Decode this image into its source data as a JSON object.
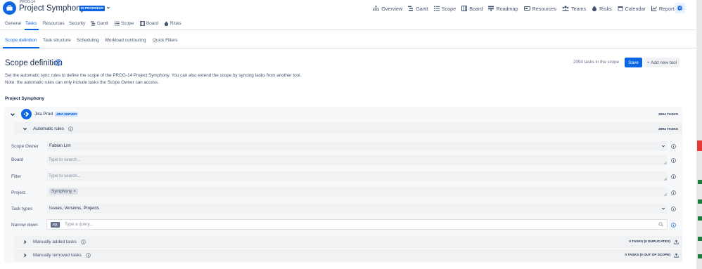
{
  "header": {
    "project_key": "PROG-14",
    "project_title": "Project Symphony",
    "status_badge": "IN PROGRESS",
    "nav": [
      {
        "label": "Overview",
        "icon": "hierarchy-icon"
      },
      {
        "label": "Gantt",
        "icon": "gantt-icon"
      },
      {
        "label": "Scope",
        "icon": "list-icon"
      },
      {
        "label": "Board",
        "icon": "board-icon"
      },
      {
        "label": "Roadmap",
        "icon": "roadmap-icon"
      },
      {
        "label": "Resources",
        "icon": "resources-icon"
      },
      {
        "label": "Teams",
        "icon": "teams-icon"
      },
      {
        "label": "Risks",
        "icon": "risks-icon"
      },
      {
        "label": "Calendar",
        "icon": "calendar-icon"
      },
      {
        "label": "Reports",
        "icon": "reports-icon"
      }
    ]
  },
  "module_tabs": [
    "General",
    "Tasks",
    "Resources",
    "Security",
    "Gantt",
    "Scope",
    "Board",
    "Risks"
  ],
  "active_module_tab": "Tasks",
  "sub_tabs": [
    "Scope definition",
    "Task structure",
    "Scheduling",
    "Workload contouring",
    "Quick Filters"
  ],
  "active_sub_tab": "Scope definition",
  "scope": {
    "title": "Scope definition",
    "task_count_text": "2094 tasks in the scope",
    "save_label": "Save",
    "add_tool_label": "+ Add new tool",
    "description": "Set the automatic sync rules to define the scope of the PROG-14 Project Symphony. You can also extend the scope by syncing tasks from another tool. Note: the automatic rules can only include tasks the Scope Owner can access.",
    "project_heading": "Project Symphony"
  },
  "integration": {
    "name": "Jira Prod",
    "badge": "JIRA SERVER",
    "count": "2094 TASKS",
    "automatic_rules": {
      "label": "Automatic rules",
      "count": "2094 TASKS"
    },
    "fields": {
      "scope_owner": {
        "label": "Scope Owner",
        "value": "Fabian Lim"
      },
      "board": {
        "label": "Board",
        "placeholder": "Type to search..."
      },
      "filter": {
        "label": "Filter",
        "placeholder": "Type to search..."
      },
      "project": {
        "label": "Project",
        "chip": "Symphony",
        "chip_remove": "×"
      },
      "task_types": {
        "label": "Task types",
        "value": "Issues, Versions, Projects"
      },
      "narrow_down": {
        "label": "Narrow down",
        "tag": "JQL",
        "placeholder": "Type a query..."
      }
    },
    "manually_added": {
      "label": "Manually added tasks",
      "count": "0 TASKS (0 DUPLICATES)"
    },
    "manually_removed": {
      "label": "Manually removed tasks",
      "count": "0 TASKS (0 OUT OF SCOPE)"
    }
  },
  "colors": {
    "accent": "#0c66e4",
    "text": "#172b4d",
    "subtle_text": "#44546f",
    "panel_bg": "#f7f8f9"
  }
}
